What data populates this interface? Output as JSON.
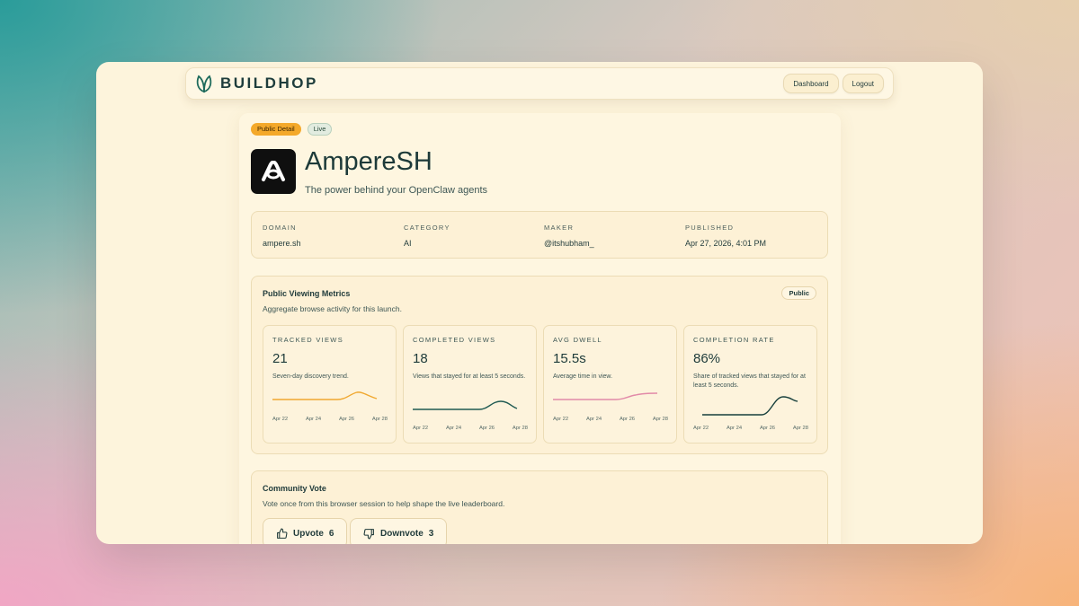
{
  "brand": {
    "name": "BUILDHOP",
    "logo_icon": "leaf-logo-icon",
    "accent": "#1e6b5c"
  },
  "nav": {
    "dashboard_label": "Dashboard",
    "logout_label": "Logout"
  },
  "product": {
    "badges": {
      "public": "Public Detail",
      "live": "Live"
    },
    "icon": "ampere-logo-icon",
    "name": "AmpereSH",
    "tagline": "The power behind your OpenClaw agents"
  },
  "info": {
    "domain": {
      "label": "DOMAIN",
      "value": "ampere.sh"
    },
    "category": {
      "label": "CATEGORY",
      "value": "AI"
    },
    "maker": {
      "label": "MAKER",
      "value": "@itshubham_"
    },
    "published": {
      "label": "PUBLISHED",
      "value": "Apr 27, 2026, 4:01 PM"
    }
  },
  "metrics": {
    "title": "Public Viewing Metrics",
    "subtitle": "Aggregate browse activity for this launch.",
    "badge": "Public",
    "cards": [
      {
        "label": "TRACKED VIEWS",
        "value": "21",
        "desc": "Seven-day discovery trend.",
        "color": "#f0a830",
        "axis": [
          "Apr 22",
          "Apr 24",
          "Apr 26",
          "Apr 28"
        ]
      },
      {
        "label": "COMPLETED VIEWS",
        "value": "18",
        "desc": "Views that stayed for at least 5 seconds.",
        "color": "#1f5a52",
        "axis": [
          "Apr 22",
          "Apr 24",
          "Apr 26",
          "Apr 28"
        ]
      },
      {
        "label": "AVG DWELL",
        "value": "15.5s",
        "desc": "Average time in view.",
        "color": "#e28aa8",
        "axis": [
          "Apr 22",
          "Apr 24",
          "Apr 26",
          "Apr 28"
        ]
      },
      {
        "label": "COMPLETION RATE",
        "value": "86%",
        "desc": "Share of tracked views that stayed for at least 5 seconds.",
        "color": "#173f3c",
        "axis": [
          "Apr 22",
          "Apr 24",
          "Apr 26",
          "Apr 28"
        ]
      }
    ]
  },
  "vote": {
    "title": "Community Vote",
    "subtitle": "Vote once from this browser session to help shape the live leaderboard.",
    "upvote_label": "Upvote",
    "upvote_count": "6",
    "downvote_label": "Downvote",
    "downvote_count": "3"
  }
}
